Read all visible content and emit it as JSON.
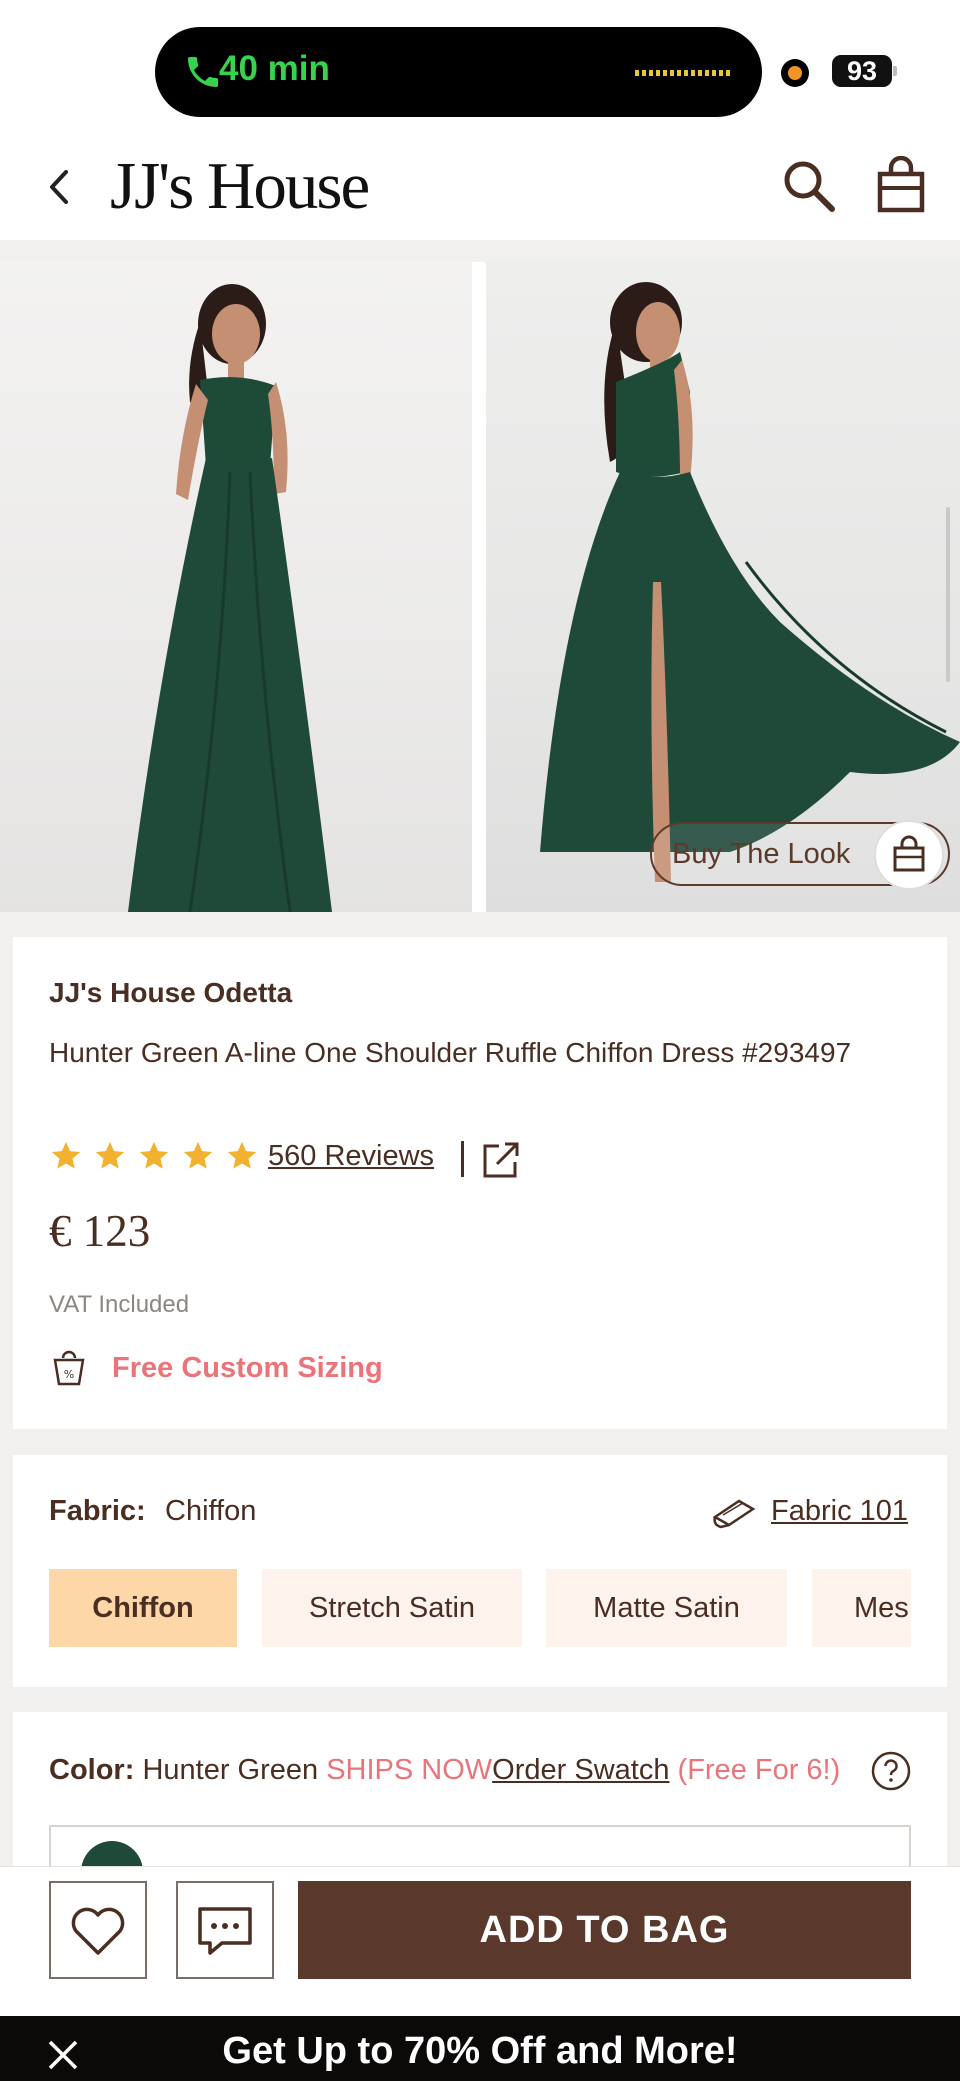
{
  "status": {
    "call_time": "40 min",
    "battery": "93"
  },
  "header": {
    "logo": "JJ's House"
  },
  "gallery": {
    "buy_the_look": "Buy The Look"
  },
  "product": {
    "brand": "JJ's House Odetta",
    "name": "Hunter Green A-line One Shoulder Ruffle Chiffon Dress #293497",
    "rating_stars": 5,
    "reviews": "560 Reviews",
    "price": "€ 123",
    "vat": "VAT Included",
    "sizing": "Free Custom Sizing"
  },
  "fabric": {
    "label": "Fabric:",
    "value": "Chiffon",
    "link": "Fabric 101",
    "options": [
      "Chiffon",
      "Stretch Satin",
      "Matte Satin",
      "Mes"
    ],
    "selected": "Chiffon"
  },
  "color": {
    "label": "Color:",
    "value": "Hunter Green",
    "ships": "SHIPS NOW",
    "swatch_link": "Order Swatch",
    "swatch_note": "(Free For 6!)"
  },
  "actions": {
    "add_to_bag": "ADD TO BAG"
  },
  "promo": {
    "text": "Get Up to 70% Off and More!"
  },
  "colors": {
    "brand_brown": "#5a392c",
    "accent_pink": "#ea7479",
    "chip_active": "#fdd7a8",
    "star_gold": "#f2b230",
    "dress_green": "#1f4a3a"
  }
}
